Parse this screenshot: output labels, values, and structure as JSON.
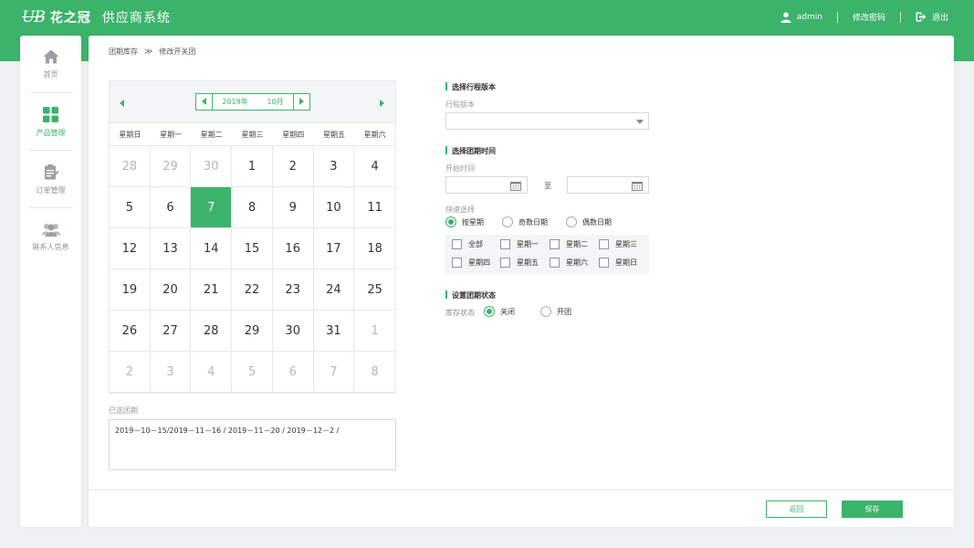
{
  "header": {
    "logo_mark": "UB",
    "logo_name": "花之冠",
    "system_title": "供应商系统",
    "user": "admin",
    "change_password": "修改密码",
    "logout": "退出"
  },
  "sidebar": {
    "items": [
      {
        "label": "首页",
        "icon": "home-icon",
        "active": false
      },
      {
        "label": "产品管理",
        "icon": "grid-icon",
        "active": true
      },
      {
        "label": "订单管理",
        "icon": "order-icon",
        "active": false
      },
      {
        "label": "联系人信息",
        "icon": "contacts-icon",
        "active": false
      }
    ]
  },
  "breadcrumb": {
    "parent": "团期库存",
    "separator": "≫",
    "current": "修改开关团"
  },
  "calendar": {
    "year": "2019年",
    "month": "10月",
    "weekdays": [
      "星期日",
      "星期一",
      "星期二",
      "星期三",
      "星期四",
      "星期五",
      "星期六"
    ],
    "days": [
      {
        "d": "28",
        "out": true
      },
      {
        "d": "29",
        "out": true
      },
      {
        "d": "30",
        "out": true
      },
      {
        "d": "1"
      },
      {
        "d": "2"
      },
      {
        "d": "3"
      },
      {
        "d": "4"
      },
      {
        "d": "5"
      },
      {
        "d": "6"
      },
      {
        "d": "7",
        "sel": true
      },
      {
        "d": "8"
      },
      {
        "d": "9"
      },
      {
        "d": "10"
      },
      {
        "d": "11"
      },
      {
        "d": "12"
      },
      {
        "d": "13"
      },
      {
        "d": "14"
      },
      {
        "d": "15"
      },
      {
        "d": "16"
      },
      {
        "d": "17"
      },
      {
        "d": "18"
      },
      {
        "d": "19"
      },
      {
        "d": "20"
      },
      {
        "d": "21"
      },
      {
        "d": "22"
      },
      {
        "d": "23"
      },
      {
        "d": "24"
      },
      {
        "d": "25"
      },
      {
        "d": "26"
      },
      {
        "d": "27"
      },
      {
        "d": "28"
      },
      {
        "d": "29"
      },
      {
        "d": "30"
      },
      {
        "d": "31"
      },
      {
        "d": "1",
        "out": true
      },
      {
        "d": "2",
        "out": true
      },
      {
        "d": "3",
        "out": true
      },
      {
        "d": "4",
        "out": true
      },
      {
        "d": "5",
        "out": true
      },
      {
        "d": "6",
        "out": true
      },
      {
        "d": "7",
        "out": true
      },
      {
        "d": "8",
        "out": true
      }
    ]
  },
  "selected_dates": {
    "label": "已选团期",
    "value": "2019－10－15/2019－11－16 / 2019－11－20 / 2019－12－2 /"
  },
  "route_version": {
    "section_title": "选择行程版本",
    "label": "行程版本",
    "value": ""
  },
  "tour_time": {
    "section_title": "选择团期时间",
    "start_label": "开始时间",
    "start_value": "",
    "to_label": "至",
    "end_value": ""
  },
  "quick_select": {
    "label": "快速选择",
    "options": [
      {
        "label": "按星期",
        "checked": true
      },
      {
        "label": "奇数日期",
        "checked": false
      },
      {
        "label": "偶数日期",
        "checked": false
      }
    ],
    "weekdays": [
      "全部",
      "星期一",
      "星期二",
      "星期三",
      "星期四",
      "星期五",
      "星期六",
      "星期日"
    ]
  },
  "status": {
    "section_title": "设置团期状态",
    "label": "库存状态",
    "options": [
      {
        "label": "关闭",
        "checked": true
      },
      {
        "label": "开团",
        "checked": false
      }
    ]
  },
  "footer": {
    "back": "返回",
    "save": "保存"
  },
  "colors": {
    "accent": "#3cb36b",
    "background": "#eef0f2"
  }
}
